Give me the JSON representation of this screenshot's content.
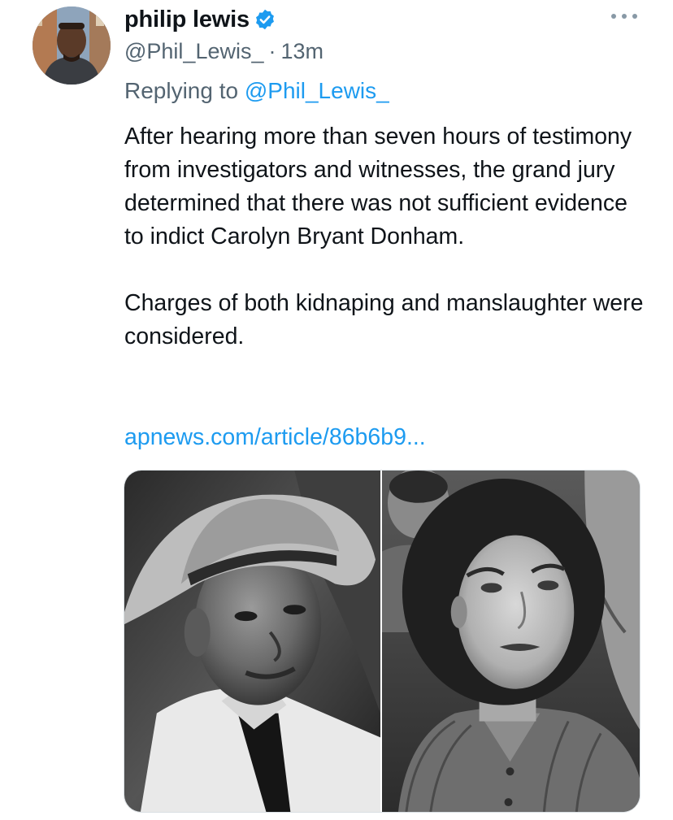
{
  "author": {
    "name": "philip lewis",
    "handle": "@Phil_Lewis_",
    "separator": "·",
    "time": "13m",
    "verified": true,
    "avatar_icon": "avatar-photo"
  },
  "reply": {
    "prefix": "Replying to ",
    "mention": "@Phil_Lewis_"
  },
  "tweet": {
    "paragraph1": "After hearing more than seven hours of testimony from investigators and witnesses, the grand jury determined that there was not sufficient evidence to indict Carolyn Bryant Donham.",
    "paragraph2": "Charges of both kidnaping and manslaughter were considered.",
    "link": "apnews.com/article/86b6b9..."
  },
  "media": {
    "images": [
      "left-photo",
      "right-photo"
    ]
  },
  "colors": {
    "link": "#1d9bf0",
    "secondary_text": "#536471",
    "verified": "#1d9bf0"
  }
}
